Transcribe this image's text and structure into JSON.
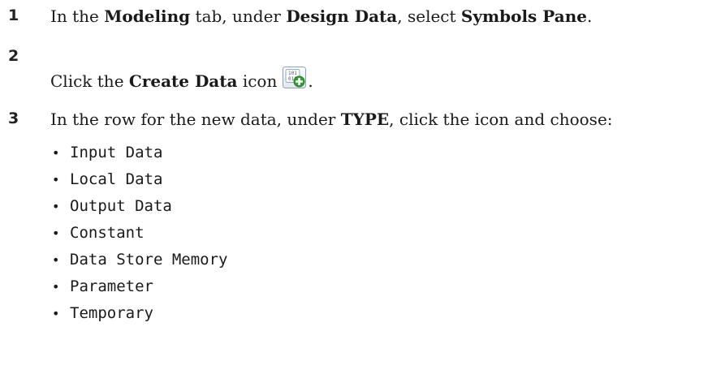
{
  "steps": [
    {
      "number": "1",
      "parts": {
        "t1": "In the ",
        "b1": "Modeling",
        "t2": " tab, under ",
        "b2": "Design Data",
        "t3": ", select ",
        "b3": "Symbols Pane",
        "t4": "."
      }
    },
    {
      "number": "2",
      "parts": {
        "t1": "Click the ",
        "b1": "Create Data",
        "t2": " icon",
        "t3": "."
      },
      "icon": "create-data-icon"
    },
    {
      "number": "3",
      "parts": {
        "t1": "In the row for the new data, under ",
        "b1": "TYPE",
        "t2": ", click the icon and choose:"
      }
    }
  ],
  "options": [
    "Input Data",
    "Local Data",
    "Output Data",
    "Constant",
    "Data Store Memory",
    "Parameter",
    "Temporary"
  ],
  "bullet": "•",
  "colors": {
    "icon_green": "#3a9a3a",
    "icon_frame": "#7f9db9"
  }
}
